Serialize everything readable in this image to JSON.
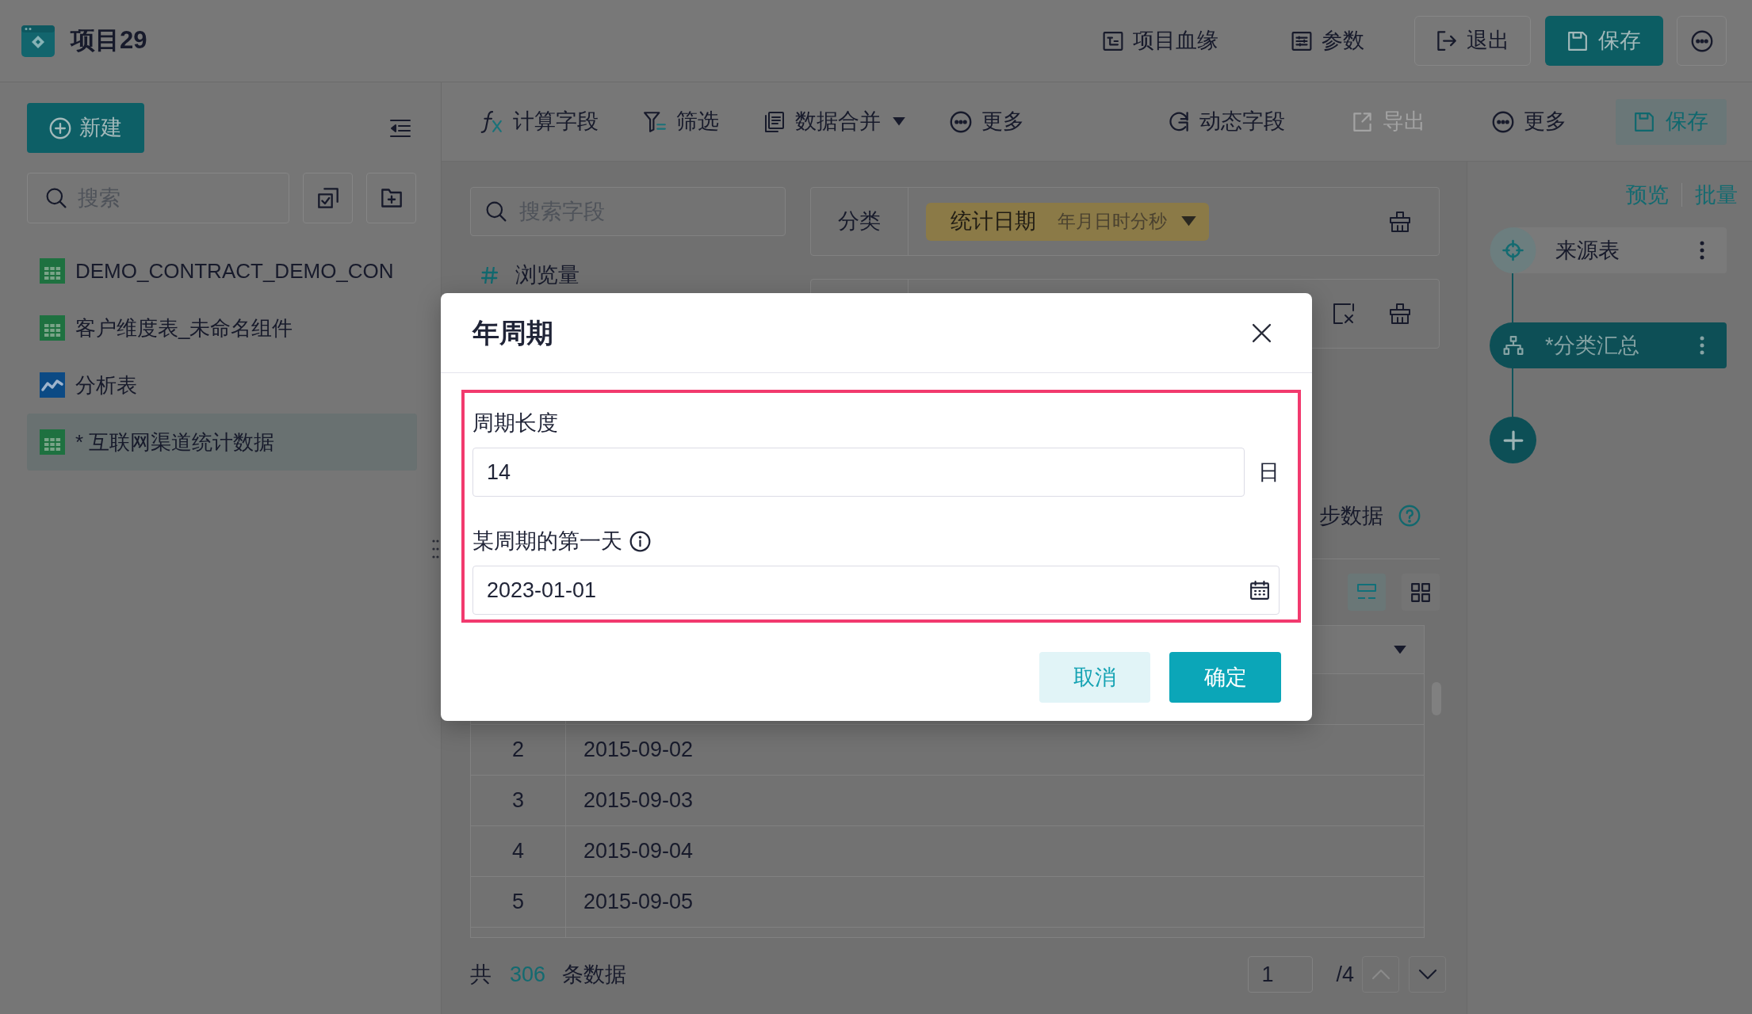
{
  "header": {
    "title": "项目29",
    "actions": [
      {
        "kind": "text",
        "label": "项目血缘"
      },
      {
        "kind": "text",
        "label": "参数"
      },
      {
        "kind": "outline",
        "label": "退出"
      },
      {
        "kind": "primary",
        "label": "保存"
      },
      {
        "kind": "icon"
      }
    ]
  },
  "sidebar": {
    "new_button": "新建",
    "search": {
      "placeholder": "搜索"
    },
    "items": [
      {
        "kind": "table",
        "label": "DEMO_CONTRACT_DEMO_CON",
        "selected": false
      },
      {
        "kind": "table",
        "label": "客户维度表_未命名组件",
        "selected": false
      },
      {
        "kind": "chart",
        "label": "分析表",
        "selected": false
      },
      {
        "kind": "table",
        "label": "* 互联网渠道统计数据",
        "selected": true
      }
    ]
  },
  "toolbar": {
    "left": [
      {
        "kind": "plain",
        "label": "计算字段",
        "disabled": false
      },
      {
        "kind": "plain",
        "label": "筛选",
        "disabled": false
      },
      {
        "kind": "dropdown",
        "label": "数据合并",
        "disabled": false
      },
      {
        "kind": "plain",
        "label": "更多",
        "disabled": false
      }
    ],
    "right": [
      {
        "kind": "plain",
        "label": "动态字段",
        "disabled": false
      },
      {
        "kind": "plain",
        "label": "导出",
        "disabled": true
      },
      {
        "kind": "plain",
        "label": "更多",
        "disabled": false
      },
      {
        "kind": "primary",
        "label": "保存",
        "disabled": false
      }
    ]
  },
  "fields_panel": {
    "search": {
      "placeholder": "搜索字段"
    },
    "fields": [
      {
        "kind": "number",
        "label": "浏览量"
      }
    ]
  },
  "config": {
    "rows": [
      {
        "label": "分类",
        "tags": [
          {
            "label": "统计日期",
            "detail": "年月日时分秒"
          }
        ]
      }
    ],
    "note": "步数据",
    "view_modes": [
      {
        "selected": true
      },
      {
        "selected": false
      }
    ]
  },
  "table": {
    "rows": [
      {
        "cells": [
          "2",
          "2015-09-02"
        ]
      },
      {
        "cells": [
          "3",
          "2015-09-03"
        ]
      },
      {
        "cells": [
          "4",
          "2015-09-04"
        ]
      },
      {
        "cells": [
          "5",
          "2015-09-05"
        ]
      }
    ]
  },
  "footer": {
    "prefix": "共",
    "count": "306",
    "suffix": "条数据",
    "page": "1",
    "page_count": "/4",
    "prev_disabled": true,
    "next_disabled": false
  },
  "flow": {
    "links": [
      "预览",
      "批量"
    ],
    "nodes": [
      {
        "kind": "source",
        "label": "来源表",
        "selected": false
      },
      {
        "kind": "summary",
        "label": "*分类汇总",
        "selected": true
      }
    ]
  },
  "dialog": {
    "title": "年周期",
    "highlighted": true,
    "fields": [
      {
        "kind": "number",
        "label": "周期长度",
        "value": "14",
        "unit": "日",
        "hint": false
      },
      {
        "kind": "date",
        "label": "某周期的第一天",
        "value": "2023-01-01",
        "hint": true
      }
    ],
    "buttons": [
      {
        "kind": "secondary",
        "label": "取消"
      },
      {
        "kind": "primary",
        "label": "确定"
      }
    ]
  }
}
